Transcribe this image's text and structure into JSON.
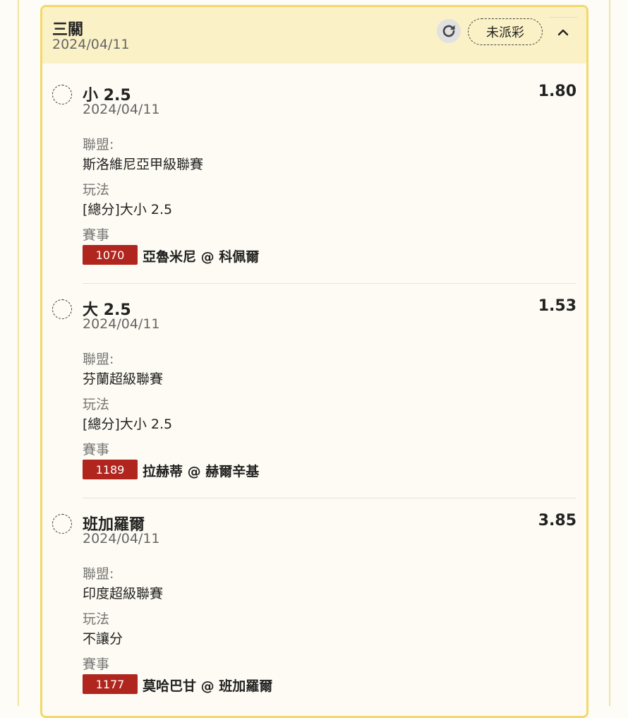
{
  "header": {
    "title": "三關",
    "date": "2024/04/11",
    "status": "未派彩"
  },
  "labels": {
    "league": "聯盟:",
    "bet_type": "玩法",
    "match": "賽事"
  },
  "legs": [
    {
      "selection": "小 2.5",
      "date": "2024/04/11",
      "odds": "1.80",
      "league": "斯洛維尼亞甲級聯賽",
      "bet_type": "[總分]大小 2.5",
      "match_id": "1070",
      "match": "亞魯米尼 @ 科佩爾"
    },
    {
      "selection": "大 2.5",
      "date": "2024/04/11",
      "odds": "1.53",
      "league": "芬蘭超級聯賽",
      "bet_type": "[總分]大小 2.5",
      "match_id": "1189",
      "match": "拉赫蒂 @ 赫爾辛基"
    },
    {
      "selection": "班加羅爾",
      "date": "2024/04/11",
      "odds": "3.85",
      "league": "印度超級聯賽",
      "bet_type": "不讓分",
      "match_id": "1177",
      "match": "莫哈巴甘 @ 班加羅爾"
    }
  ],
  "icons": {
    "refresh": "refresh-icon",
    "collapse": "chevron-up-icon",
    "status_circle": "pending-circle-icon"
  },
  "colors": {
    "header_bg": "#fbf1c6",
    "card_border": "#f3d86a",
    "badge_bg": "#b0261e"
  }
}
